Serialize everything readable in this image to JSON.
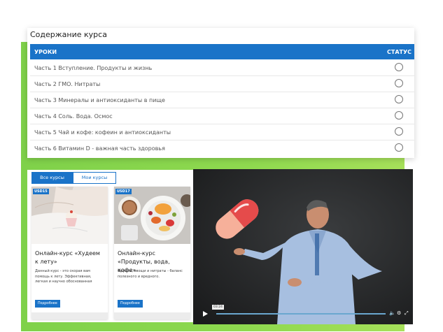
{
  "course": {
    "title": "Содержание курса",
    "col_lessons": "УРОКИ",
    "col_status": "СТАТУС",
    "lessons": [
      "Часть 1 Вступление. Продукты и жизнь",
      "Часть 2 ГМО. Нитраты",
      "Часть 3 Минералы и антиоксиданты в пище",
      "Часть 4 Соль. Вода. Осмос",
      "Часть 5 Чай и кофе: кофеин и антиоксиданты",
      "Часть 6 Витамин D - важная часть здоровья"
    ]
  },
  "catalog": {
    "tabs": [
      "Все курсы",
      "Мои курсы"
    ],
    "cards": [
      {
        "price": "USD15",
        "title": "Онлайн-курс «Худеем к лету»",
        "desc": "Данный курс - это скорая вам помощь к лету. Эффективная, легкая и научно обоснованная",
        "button": "Подробнее"
      },
      {
        "price": "USD17",
        "title": "Онлайн-курс «Продукты, вода, кофе»",
        "desc": "Фрукты, овощи и нитраты - баланс полезного и вредного.",
        "button": "Подробнее"
      }
    ]
  },
  "player": {
    "time": "03:24",
    "progress": 0.0
  },
  "colors": {
    "accent": "#1a73c8",
    "green": "#8fd94f",
    "pill_red": "#e54b4b",
    "pill_pink": "#f6b09a"
  }
}
